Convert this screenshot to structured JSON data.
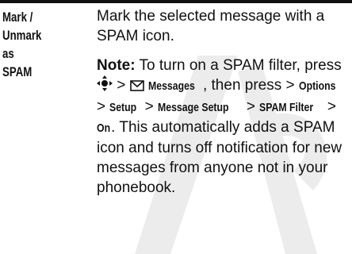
{
  "term": "Mark /\nUnmark as\nSPAM",
  "description": "Mark the selected message with a SPAM icon.",
  "note": {
    "lead": "Note:",
    "text1": " To turn on a SPAM filter, press ",
    "gt1": " > ",
    "messages": "Messages",
    "text2": ", then press > ",
    "options": "Options",
    "gt2": " > ",
    "setup": "Setup",
    "gt3": " > ",
    "message_setup": "Message Setup",
    "gt4": " > ",
    "spam_filter": "SPAM Filter",
    "gt5": " > ",
    "on": "On",
    "text3": ". This automatically adds a SPAM icon and turns off notification for new messages from anyone not in your phonebook."
  },
  "icons": {
    "nav": "nav-key-icon",
    "mail": "envelope-icon"
  },
  "colors": {
    "text": "#111111",
    "watermark": "#ececec"
  }
}
